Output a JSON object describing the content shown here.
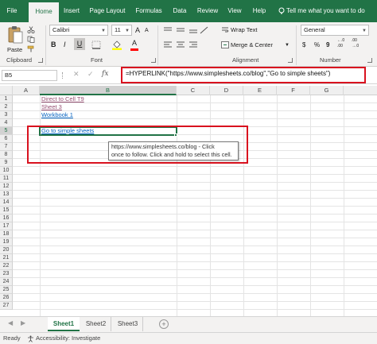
{
  "ribbon_tabs": [
    "File",
    "Home",
    "Insert",
    "Page Layout",
    "Formulas",
    "Data",
    "Review",
    "View",
    "Help"
  ],
  "active_tab_index": 1,
  "tell_me": "Tell me what you want to do",
  "clipboard": {
    "paste_label": "Paste",
    "group_label": "Clipboard"
  },
  "font": {
    "name": "Calibri",
    "size": "11",
    "bold": "B",
    "italic": "I",
    "underline": "U",
    "grow": "A",
    "shrink": "A",
    "font_color": "A",
    "group_label": "Font"
  },
  "alignment": {
    "wrap_text": "Wrap Text",
    "merge_center": "Merge & Center",
    "group_label": "Alignment"
  },
  "number": {
    "format": "General",
    "currency": "$",
    "percent": "%",
    "comma": "9",
    "increase_decimal": "←.0 .00",
    "decrease_decimal": ".00 →.0",
    "group_label": "Number"
  },
  "formula_bar": {
    "name_box": "B5",
    "cancel": "✕",
    "enter": "✓",
    "fx": "fx",
    "formula": "=HYPERLINK(\"https://www.simplesheets.co/blog\",\"Go to simple sheets\")"
  },
  "columns": [
    "A",
    "B",
    "C",
    "D",
    "E",
    "F",
    "G"
  ],
  "rows": [
    "1",
    "2",
    "3",
    "4",
    "5",
    "6",
    "7",
    "8",
    "9",
    "10",
    "11",
    "12",
    "13",
    "14",
    "15",
    "16",
    "17",
    "18",
    "19",
    "20",
    "21",
    "22",
    "23",
    "24",
    "25",
    "26",
    "27"
  ],
  "cells": {
    "b1": "Direct to Cell T9",
    "b2": "Sheet 3",
    "b3": "Workbook 1",
    "b5": "Go to simple sheets"
  },
  "tooltip": {
    "line1": "https://www.simplesheets.co/blog - Click",
    "line2": "once to follow. Click and hold to select this cell."
  },
  "sheet_tabs": [
    "Sheet1",
    "Sheet2",
    "Sheet3"
  ],
  "active_sheet_index": 0,
  "add_sheet": "+",
  "status": {
    "ready": "Ready",
    "accessibility": "Accessibility: Investigate"
  },
  "colors": {
    "excel_green": "#217346",
    "highlight_red": "#d9121f",
    "link_visited": "#954f72",
    "link_blue": "#0563c1"
  }
}
